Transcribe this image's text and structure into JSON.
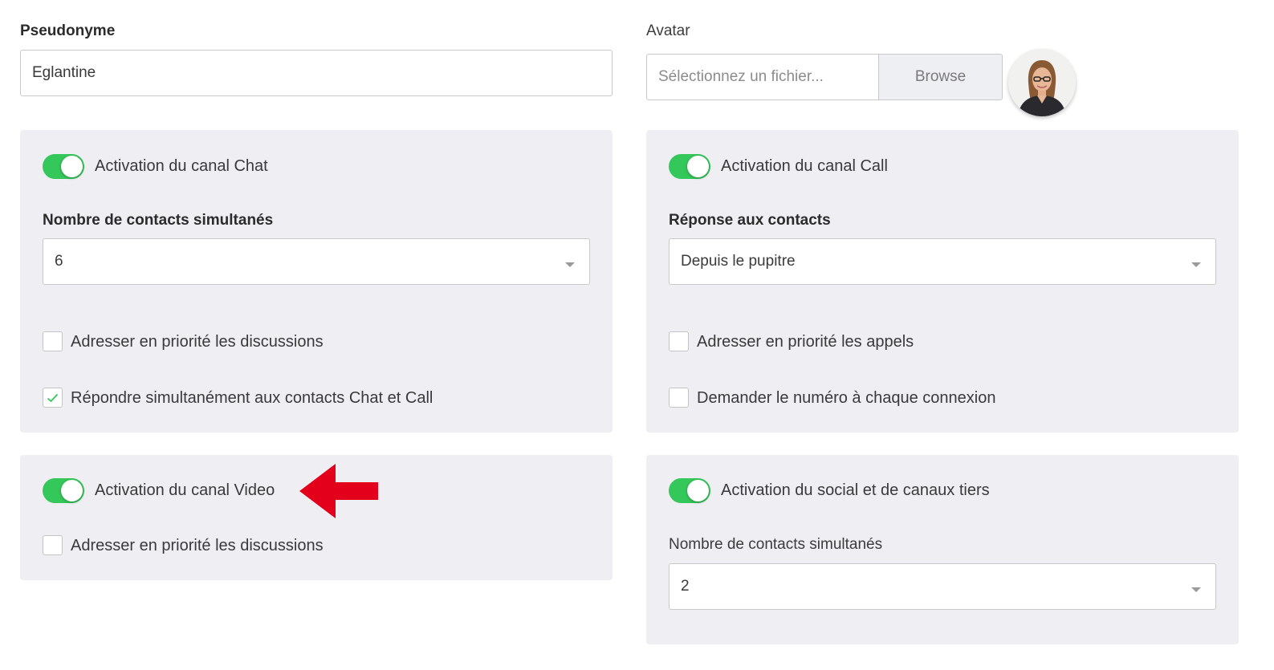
{
  "pseudonyme": {
    "label": "Pseudonyme",
    "value": "Eglantine"
  },
  "avatar": {
    "label": "Avatar",
    "placeholder": "Sélectionnez un fichier...",
    "browse_label": "Browse"
  },
  "chat": {
    "toggle_label": "Activation du canal Chat",
    "toggle_on": true,
    "contacts_label": "Nombre de contacts simultanés",
    "contacts_value": "6",
    "priority_label": "Adresser en priorité les discussions",
    "priority_checked": false,
    "simultaneous_label": "Répondre simultanément aux contacts Chat et Call",
    "simultaneous_checked": true
  },
  "call": {
    "toggle_label": "Activation du canal Call",
    "toggle_on": true,
    "response_label": "Réponse aux contacts",
    "response_value": "Depuis le pupitre",
    "priority_label": "Adresser en priorité les appels",
    "priority_checked": false,
    "ask_number_label": "Demander le numéro à chaque connexion",
    "ask_number_checked": false
  },
  "video": {
    "toggle_label": "Activation du canal Video",
    "toggle_on": true,
    "priority_label": "Adresser en priorité les discussions",
    "priority_checked": false
  },
  "social": {
    "toggle_label": "Activation du social et de canaux tiers",
    "toggle_on": true,
    "contacts_label": "Nombre de contacts simultanés",
    "contacts_value": "2"
  },
  "colors": {
    "toggle_on": "#34c759",
    "annotation_arrow": "#e3001b",
    "panel_bg": "#eeeef3"
  }
}
